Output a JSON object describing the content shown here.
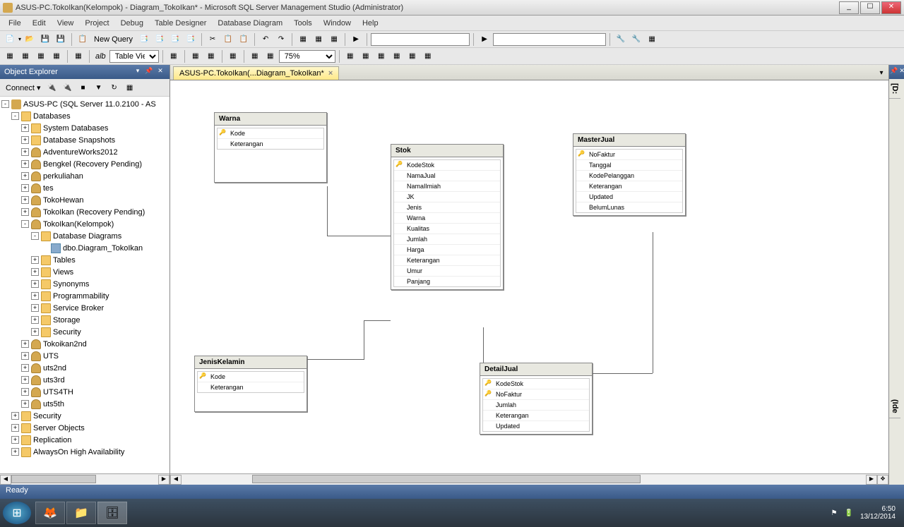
{
  "window": {
    "title": "ASUS-PC.TokoIkan(Kelompok) - Diagram_TokoIkan* - Microsoft SQL Server Management Studio (Administrator)"
  },
  "menubar": [
    "File",
    "Edit",
    "View",
    "Project",
    "Debug",
    "Table Designer",
    "Database Diagram",
    "Tools",
    "Window",
    "Help"
  ],
  "toolbar": {
    "new_query": "New Query",
    "table_view": "Table View",
    "zoom": "75%",
    "alb": "alb"
  },
  "object_explorer": {
    "title": "Object Explorer",
    "connect": "Connect",
    "server": "ASUS-PC (SQL Server 11.0.2100 - AS",
    "nodes": [
      {
        "l": 1,
        "exp": "-",
        "ico": "folder",
        "txt": "Databases"
      },
      {
        "l": 2,
        "exp": "+",
        "ico": "folder",
        "txt": "System Databases"
      },
      {
        "l": 2,
        "exp": "+",
        "ico": "folder",
        "txt": "Database Snapshots"
      },
      {
        "l": 2,
        "exp": "+",
        "ico": "db",
        "txt": "AdventureWorks2012"
      },
      {
        "l": 2,
        "exp": "+",
        "ico": "db",
        "txt": "Bengkel (Recovery Pending)"
      },
      {
        "l": 2,
        "exp": "+",
        "ico": "db",
        "txt": "perkuliahan"
      },
      {
        "l": 2,
        "exp": "+",
        "ico": "db",
        "txt": "tes"
      },
      {
        "l": 2,
        "exp": "+",
        "ico": "db",
        "txt": "TokoHewan"
      },
      {
        "l": 2,
        "exp": "+",
        "ico": "db",
        "txt": "TokoIkan (Recovery Pending)"
      },
      {
        "l": 2,
        "exp": "-",
        "ico": "db",
        "txt": "TokoIkan(Kelompok)"
      },
      {
        "l": 3,
        "exp": "-",
        "ico": "folder",
        "txt": "Database Diagrams"
      },
      {
        "l": 4,
        "exp": "",
        "ico": "diag",
        "txt": "dbo.Diagram_TokoIkan"
      },
      {
        "l": 3,
        "exp": "+",
        "ico": "folder",
        "txt": "Tables"
      },
      {
        "l": 3,
        "exp": "+",
        "ico": "folder",
        "txt": "Views"
      },
      {
        "l": 3,
        "exp": "+",
        "ico": "folder",
        "txt": "Synonyms"
      },
      {
        "l": 3,
        "exp": "+",
        "ico": "folder",
        "txt": "Programmability"
      },
      {
        "l": 3,
        "exp": "+",
        "ico": "folder",
        "txt": "Service Broker"
      },
      {
        "l": 3,
        "exp": "+",
        "ico": "folder",
        "txt": "Storage"
      },
      {
        "l": 3,
        "exp": "+",
        "ico": "folder",
        "txt": "Security"
      },
      {
        "l": 2,
        "exp": "+",
        "ico": "db",
        "txt": "Tokoikan2nd"
      },
      {
        "l": 2,
        "exp": "+",
        "ico": "db",
        "txt": "UTS"
      },
      {
        "l": 2,
        "exp": "+",
        "ico": "db",
        "txt": "uts2nd"
      },
      {
        "l": 2,
        "exp": "+",
        "ico": "db",
        "txt": "uts3rd"
      },
      {
        "l": 2,
        "exp": "+",
        "ico": "db",
        "txt": "UTS4TH"
      },
      {
        "l": 2,
        "exp": "+",
        "ico": "db",
        "txt": "uts5th"
      },
      {
        "l": 1,
        "exp": "+",
        "ico": "folder",
        "txt": "Security"
      },
      {
        "l": 1,
        "exp": "+",
        "ico": "folder",
        "txt": "Server Objects"
      },
      {
        "l": 1,
        "exp": "+",
        "ico": "folder",
        "txt": "Replication"
      },
      {
        "l": 1,
        "exp": "+",
        "ico": "folder",
        "txt": "AlwaysOn High Availability"
      }
    ]
  },
  "tab": {
    "label": "ASUS-PC.TokoIkan(...Diagram_TokoIkan*"
  },
  "tables": {
    "warna": {
      "name": "Warna",
      "cols": [
        {
          "n": "Kode",
          "k": true
        },
        {
          "n": "Keterangan",
          "k": false
        }
      ]
    },
    "stok": {
      "name": "Stok",
      "cols": [
        {
          "n": "KodeStok",
          "k": true
        },
        {
          "n": "NamaJual",
          "k": false
        },
        {
          "n": "NamaIlmiah",
          "k": false
        },
        {
          "n": "JK",
          "k": false
        },
        {
          "n": "Jenis",
          "k": false
        },
        {
          "n": "Warna",
          "k": false
        },
        {
          "n": "Kualitas",
          "k": false
        },
        {
          "n": "Jumlah",
          "k": false
        },
        {
          "n": "Harga",
          "k": false
        },
        {
          "n": "Keterangan",
          "k": false
        },
        {
          "n": "Umur",
          "k": false
        },
        {
          "n": "Panjang",
          "k": false
        }
      ]
    },
    "masterjual": {
      "name": "MasterJual",
      "cols": [
        {
          "n": "NoFaktur",
          "k": true
        },
        {
          "n": "Tanggal",
          "k": false
        },
        {
          "n": "KodePelanggan",
          "k": false
        },
        {
          "n": "Keterangan",
          "k": false
        },
        {
          "n": "Updated",
          "k": false
        },
        {
          "n": "BelumLunas",
          "k": false
        }
      ]
    },
    "jeniskelamin": {
      "name": "JenisKelamin",
      "cols": [
        {
          "n": "Kode",
          "k": true
        },
        {
          "n": "Keterangan",
          "k": false
        }
      ]
    },
    "detailjual": {
      "name": "DetailJual",
      "cols": [
        {
          "n": "KodeStok",
          "k": true
        },
        {
          "n": "NoFaktur",
          "k": true
        },
        {
          "n": "Jumlah",
          "k": false
        },
        {
          "n": "Keterangan",
          "k": false
        },
        {
          "n": "Updated",
          "k": false
        }
      ]
    }
  },
  "rightpane": {
    "t1": "[D:",
    "t2": "(Ide"
  },
  "status": "Ready",
  "clock": {
    "time": "6:50",
    "date": "13/12/2014"
  }
}
